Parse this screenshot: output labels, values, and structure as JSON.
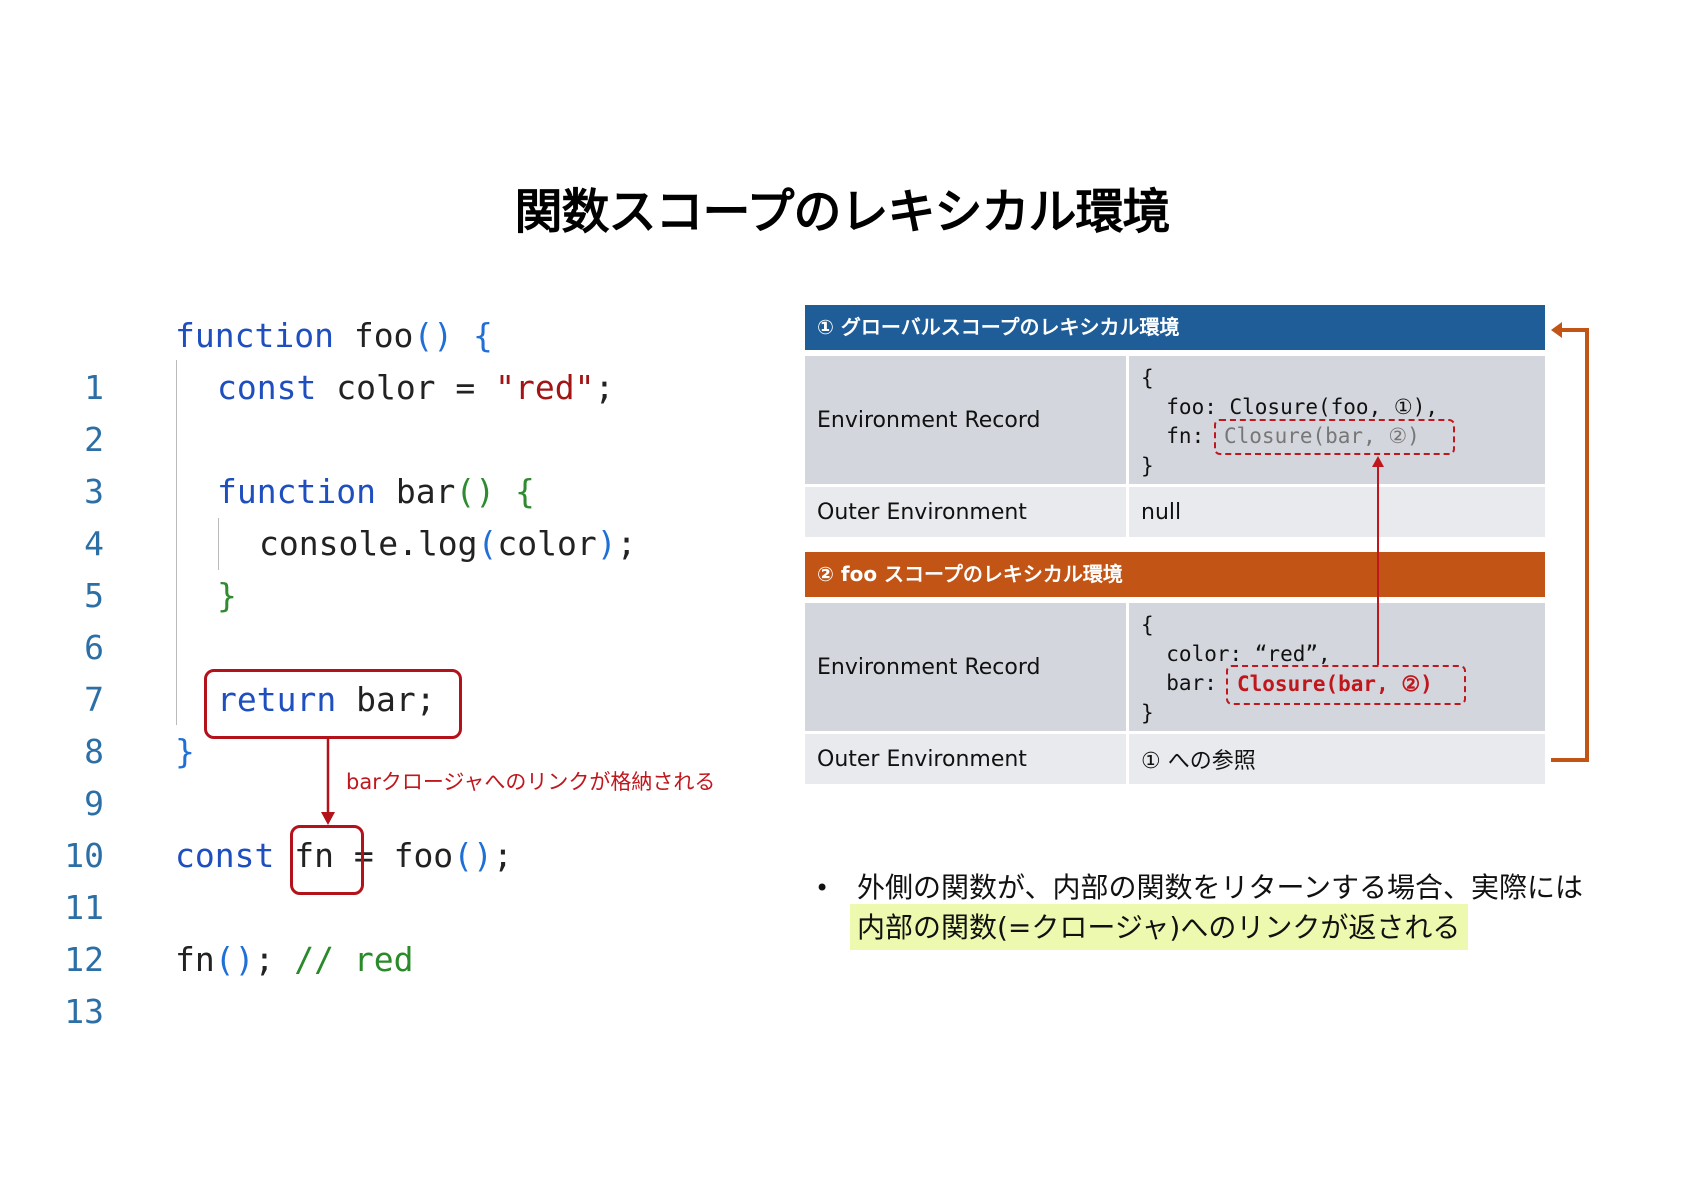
{
  "title": "関数スコープのレキシカル環境",
  "code": {
    "line_numbers": [
      "1",
      "2",
      "3",
      "4",
      "5",
      "6",
      "7",
      "8",
      "9",
      "10",
      "11",
      "12",
      "13"
    ],
    "lines": {
      "l1": {
        "kw": "function",
        "name": " foo",
        "paren": "()",
        "brace": " {"
      },
      "l2": {
        "kw": "const",
        "rest": " color = ",
        "str": "\"red\"",
        "end": ";"
      },
      "l4": {
        "kw": "function",
        "name": " bar",
        "paren": "()",
        "brace": " {"
      },
      "l5": {
        "text1": "console.log",
        "paren_open": "(",
        "arg": "color",
        "paren_close": ")",
        "end": ";"
      },
      "l6": {
        "brace": "}"
      },
      "l8": {
        "kw": "return",
        "rest": " bar;"
      },
      "l9": {
        "brace": "}"
      },
      "l11": {
        "kw": "const",
        "fn": "fn",
        "rest": " = foo",
        "paren": "()",
        "end": ";"
      },
      "l13": {
        "fn": "fn",
        "paren": "()",
        "end": "; ",
        "comment": "// red"
      }
    },
    "arrow_label": "barクロージャへのリンクが格納される"
  },
  "global_env": {
    "header": "① グローバルスコープのレキシカル環境",
    "header_color": "#1f5d99",
    "env_record_label": "Environment Record",
    "record_lines": [
      "{",
      "  foo: Closure(foo, ①),",
      "  fn: ",
      "}"
    ],
    "fn_value": "Closure(bar, ②)",
    "outer_label": "Outer Environment",
    "outer_value": "null"
  },
  "foo_env": {
    "header": "② foo スコープのレキシカル環境",
    "header_color": "#c25516",
    "env_record_label": "Environment Record",
    "record_lines": [
      "{",
      "  color: “red”,",
      "  bar: ",
      "}"
    ],
    "bar_value": "Closure(bar, ②)",
    "outer_label": "Outer Environment",
    "outer_value": "① への参照"
  },
  "bullet": {
    "line1": "外側の関数が、内部の関数をリターンする場合、実際には",
    "line2": "内部の関数(=クロージャ)へのリンクが返される"
  },
  "colors": {
    "label_cell": "#d3d6dc",
    "value_cell_top": "#d3d6dc",
    "outer_cell": "#e8eaed",
    "red": "#c0171d",
    "orange": "#c25516"
  }
}
